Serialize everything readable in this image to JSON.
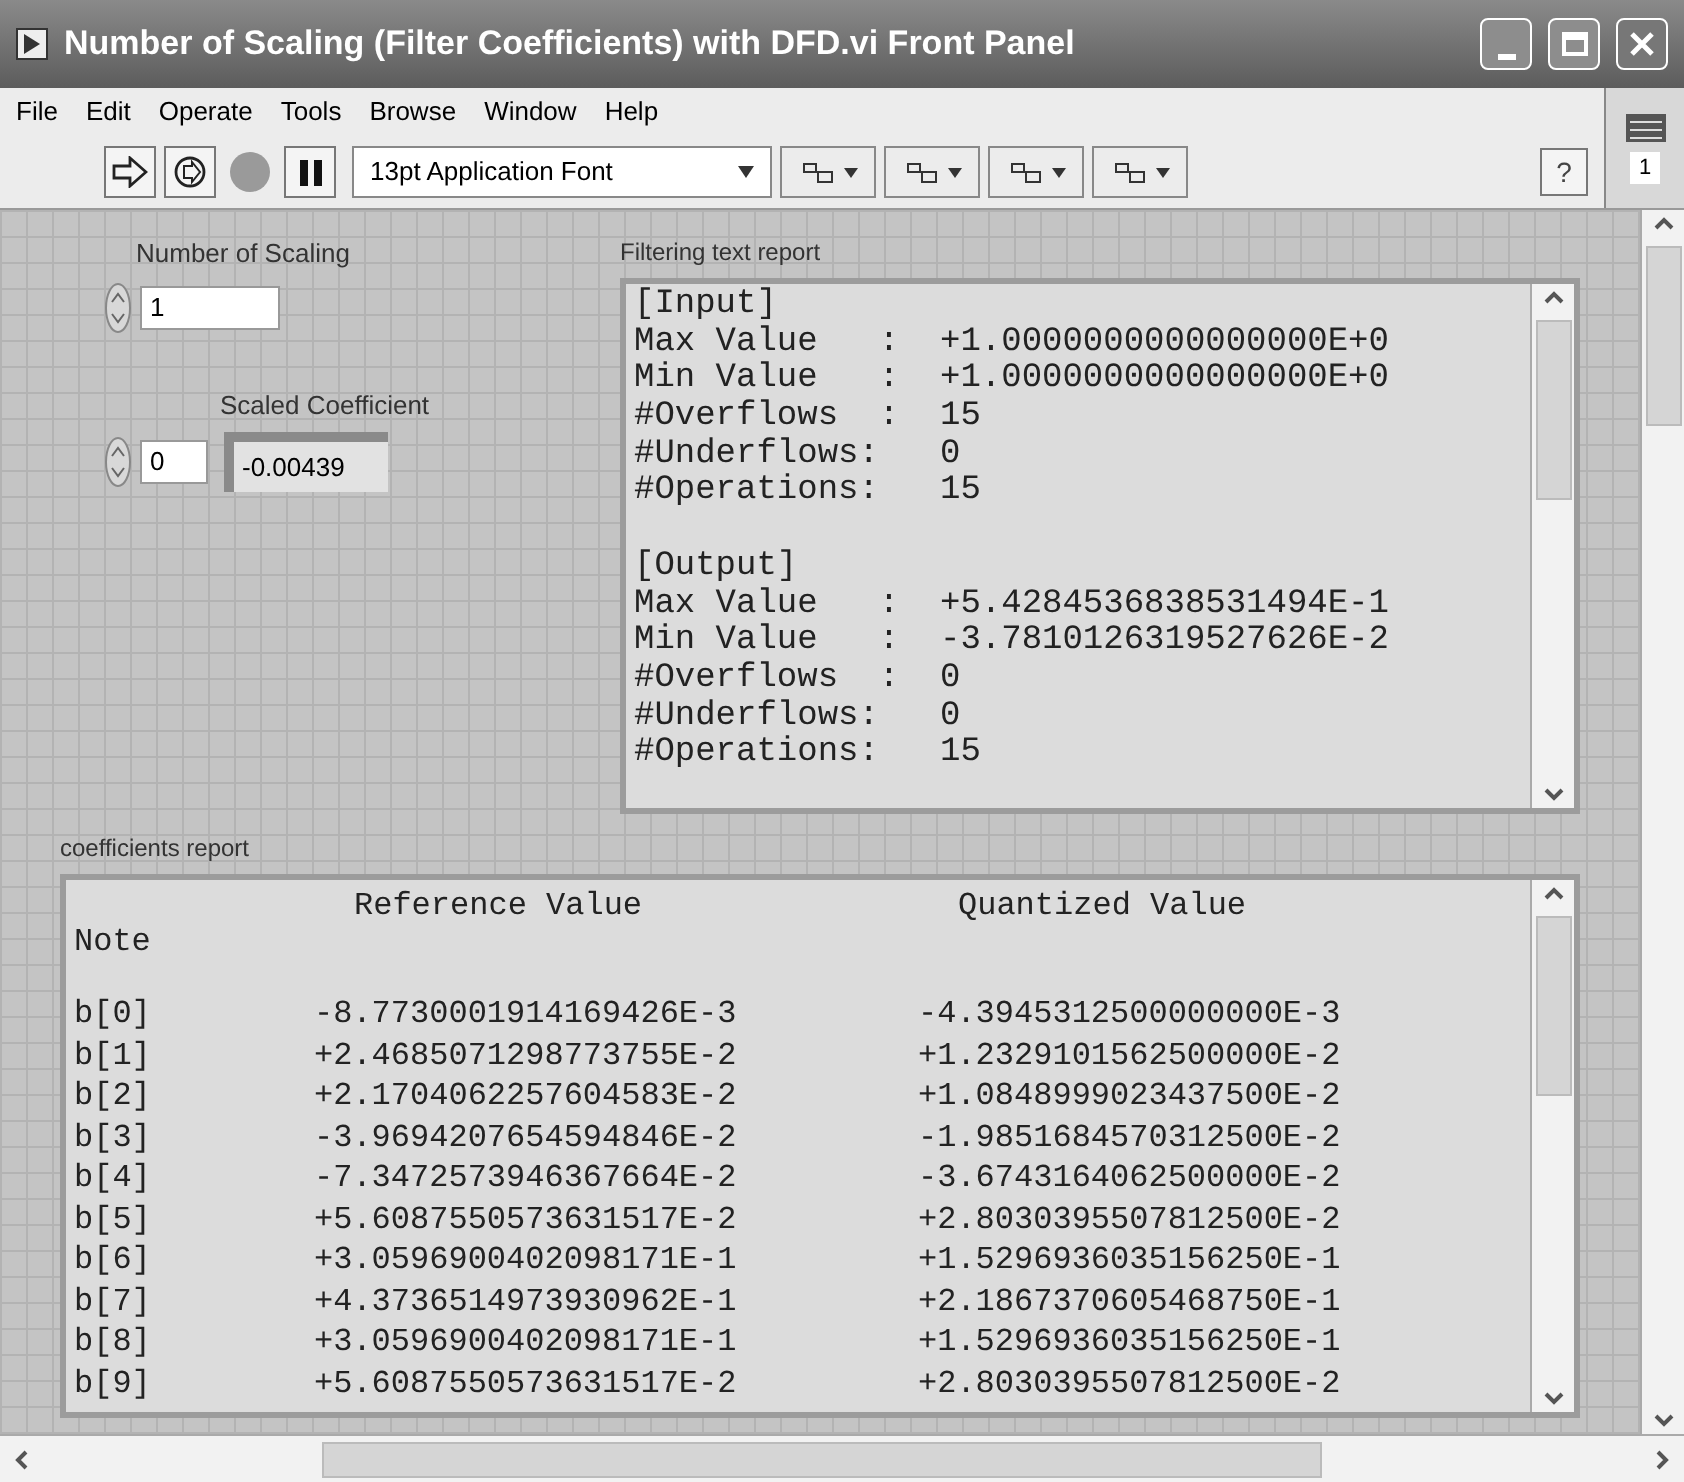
{
  "window": {
    "title": "Number of Scaling (Filter Coefficients) with DFD.vi Front Panel"
  },
  "menu": [
    "File",
    "Edit",
    "Operate",
    "Tools",
    "Browse",
    "Window",
    "Help"
  ],
  "toolbar": {
    "font": "13pt Application Font",
    "help": "?",
    "connector_label": "1"
  },
  "number_of_scaling": {
    "label": "Number of Scaling",
    "value": "1"
  },
  "scaled_coefficient": {
    "label": "Scaled Coefficient",
    "index": "0",
    "value": "-0.00439"
  },
  "filtering_report": {
    "label": "Filtering text report",
    "sections": [
      [
        "[Input]",
        "Max Value   :  +1.0000000000000000E+0",
        "Min Value   :  +1.0000000000000000E+0",
        "#Overflows  :  15",
        "#Underflows:   0",
        "#Operations:   15"
      ],
      [
        "[Output]",
        "Max Value   :  +5.4284536838531494E-1",
        "Min Value   :  -3.7810126319527626E-2",
        "#Overflows  :  0",
        "#Underflows:   0",
        "#Operations:   15"
      ]
    ]
  },
  "coefficients_report": {
    "label": "coefficients report",
    "columns": [
      "Reference Value",
      "Quantized Value"
    ],
    "note": "Note",
    "rows": [
      {
        "name": "b[0]",
        "reference": "-8.7730001914169426E-3",
        "quantized": "-4.3945312500000000E-3"
      },
      {
        "name": "b[1]",
        "reference": "+2.4685071298773755E-2",
        "quantized": "+1.2329101562500000E-2"
      },
      {
        "name": "b[2]",
        "reference": "+2.1704062257604583E-2",
        "quantized": "+1.0848999023437500E-2"
      },
      {
        "name": "b[3]",
        "reference": "-3.9694207654594846E-2",
        "quantized": "-1.9851684570312500E-2"
      },
      {
        "name": "b[4]",
        "reference": "-7.3472573946367664E-2",
        "quantized": "-3.6743164062500000E-2"
      },
      {
        "name": "b[5]",
        "reference": "+5.6087550573631517E-2",
        "quantized": "+2.8030395507812500E-2"
      },
      {
        "name": "b[6]",
        "reference": "+3.0596900402098171E-1",
        "quantized": "+1.5296936035156250E-1"
      },
      {
        "name": "b[7]",
        "reference": "+4.3736514973930962E-1",
        "quantized": "+2.1867370605468750E-1"
      },
      {
        "name": "b[8]",
        "reference": "+3.0596900402098171E-1",
        "quantized": "+1.5296936035156250E-1"
      },
      {
        "name": "b[9]",
        "reference": "+5.6087550573631517E-2",
        "quantized": "+2.8030395507812500E-2"
      }
    ]
  }
}
